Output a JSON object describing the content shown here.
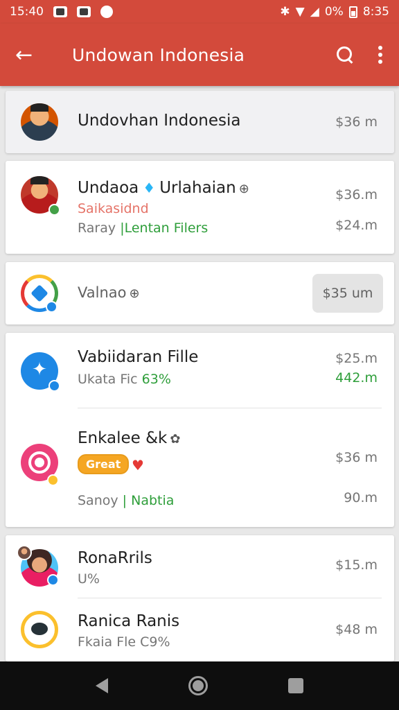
{
  "status_bar": {
    "time": "15:40",
    "battery_text": "0%",
    "clock_right": "8:35"
  },
  "app_bar": {
    "back_glyph": "←",
    "title": "Undowan Indonesia"
  },
  "items": [
    {
      "name": "Undovhan Indonesia",
      "amount": "$36 m",
      "avatar": "person-avatar"
    },
    {
      "name": "Undaoa",
      "name_suffix": "Urlahaian",
      "sub1": "Saikasidnd",
      "sub2_prefix": "Raray",
      "sub2_green": "Lentan Filers",
      "amount1": "$36.m",
      "amount2": "$24.m",
      "avatar": "person-avatar",
      "badge": "green"
    },
    {
      "name": "Valnao",
      "amount": "$35 um",
      "avatar": "multicolor-ring-icon",
      "badge": "blue"
    },
    {
      "name": "Vabiidaran Fille",
      "sub_prefix": "Ukata Fic",
      "sub_green": "63%",
      "amount1": "$25.m",
      "amount2": "442.m",
      "avatar": "blue-star-icon",
      "badge": "blue"
    },
    {
      "name": "Enkalee &k",
      "chip": "Great",
      "sub_prefix": "Sanoy",
      "sub_green": "Nabtia",
      "amount1": "$36 m",
      "amount2": "90.m",
      "avatar": "pink-target-icon",
      "badge": "orange"
    },
    {
      "name": "RonaRrils",
      "sub": "U%",
      "amount": "$15.m",
      "avatar": "person-avatar",
      "badge": "blue"
    },
    {
      "name": "Ranica  Ranis",
      "sub": "Fkaia Fle C9%",
      "amount": "$48 m",
      "avatar": "yellow-ring-icon"
    }
  ],
  "icons": {
    "search": "search-icon",
    "more": "more-vert-icon",
    "back": "arrow-back-icon"
  },
  "colors": {
    "primary": "#d34a3b",
    "green_text": "#2e9e3a",
    "chip": "#f5a623"
  }
}
